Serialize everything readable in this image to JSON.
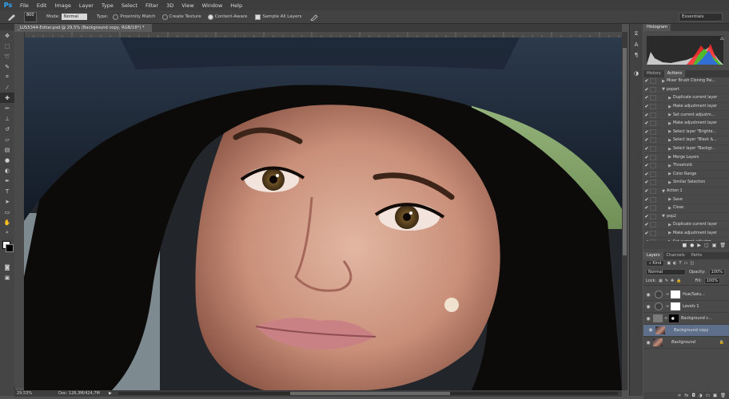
{
  "app": {
    "logo": "Ps"
  },
  "menu": [
    "File",
    "Edit",
    "Image",
    "Layer",
    "Type",
    "Select",
    "Filter",
    "3D",
    "View",
    "Window",
    "Help"
  ],
  "options": {
    "brush_size": "800",
    "mode_label": "Mode:",
    "mode_value": "Normal",
    "type_label": "Type:",
    "type_options": [
      "Proximity Match",
      "Create Texture",
      "Content-Aware"
    ],
    "type_selected": 2,
    "sample_all_label": "Sample All Layers",
    "workspace": "Essentials"
  },
  "document": {
    "tab_title": "_LUS5344-Editar.psd @ 29,5% (Background copy, RGB/16*) *",
    "zoom": "29,53%",
    "doc_info": "Doc: 126,3M/424,7M"
  },
  "tools": [
    "move-icon",
    "marquee-icon",
    "lasso-icon",
    "quick-select-icon",
    "crop-icon",
    "eyedropper-icon",
    "healing-icon",
    "brush-icon",
    "clone-stamp-icon",
    "history-brush-icon",
    "eraser-icon",
    "gradient-icon",
    "blur-icon",
    "dodge-icon",
    "pen-icon",
    "type-icon",
    "path-select-icon",
    "shape-icon",
    "hand-icon",
    "zoom-icon"
  ],
  "histogram": {
    "title": "Histogram"
  },
  "actions_panel": {
    "tabs": [
      "History",
      "Actions"
    ],
    "active_tab": 1,
    "rows": [
      {
        "label": "Mixer Brush Cloning Pai...",
        "indent": 1
      },
      {
        "label": "popart",
        "indent": 1,
        "open": true
      },
      {
        "label": "Duplicate current layer",
        "indent": 2
      },
      {
        "label": "Make adjustment layer",
        "indent": 2
      },
      {
        "label": "Set current adjustm...",
        "indent": 2
      },
      {
        "label": "Make adjustment layer",
        "indent": 2
      },
      {
        "label": "Select layer \"Brighte...",
        "indent": 2
      },
      {
        "label": "Select layer \"Black &...",
        "indent": 2
      },
      {
        "label": "Select layer \"Backgr...",
        "indent": 2
      },
      {
        "label": "Merge Layers",
        "indent": 2
      },
      {
        "label": "Threshold",
        "indent": 2
      },
      {
        "label": "Color Range",
        "indent": 2
      },
      {
        "label": "Similar Selection",
        "indent": 2
      },
      {
        "label": "Action 1",
        "indent": 1,
        "open": true
      },
      {
        "label": "Save",
        "indent": 2
      },
      {
        "label": "Close",
        "indent": 2
      },
      {
        "label": "pop2",
        "indent": 1,
        "open": true
      },
      {
        "label": "Duplicate current layer",
        "indent": 2
      },
      {
        "label": "Make adjustment layer",
        "indent": 2
      },
      {
        "label": "Set current adjustm...",
        "indent": 2
      },
      {
        "label": "Make adjustment layer",
        "indent": 2
      }
    ]
  },
  "layers_panel": {
    "tabs": [
      "Layers",
      "Channels",
      "Paths"
    ],
    "active_tab": 0,
    "kind_label": "Kind",
    "blend_mode": "Normal",
    "opacity_label": "Opacity:",
    "opacity": "100%",
    "lock_label": "Lock:",
    "fill_label": "Fill:",
    "fill": "100%",
    "layers": [
      {
        "name": "Hue/Satu...",
        "type": "adjustment",
        "selected": false,
        "italic": false
      },
      {
        "name": "Levels 1",
        "type": "adjustment",
        "selected": false,
        "italic": false
      },
      {
        "name": "Background c...",
        "type": "masked",
        "selected": false,
        "italic": false
      },
      {
        "name": "Background copy",
        "type": "image",
        "selected": true,
        "italic": false
      },
      {
        "name": "Background",
        "type": "image",
        "selected": false,
        "italic": true
      }
    ]
  },
  "colors": {
    "accent": "#31a8ff",
    "selection": "#5d6f8a"
  }
}
